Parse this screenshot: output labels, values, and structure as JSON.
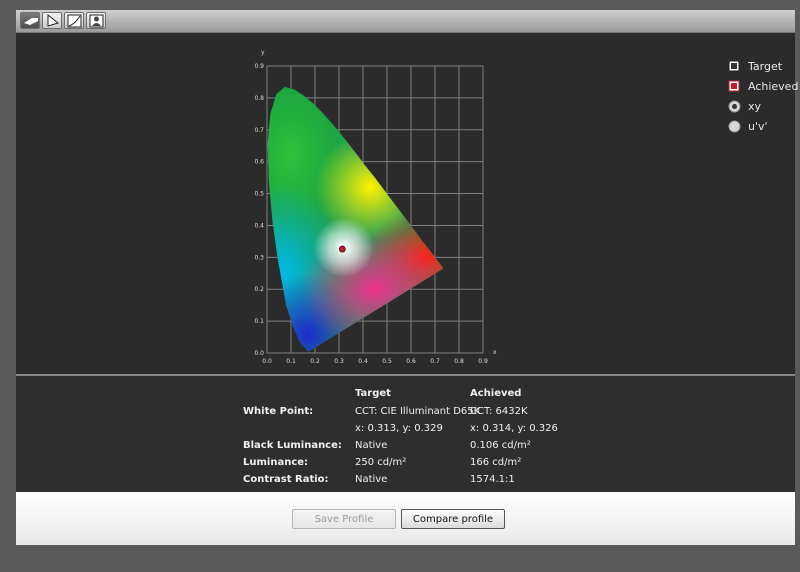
{
  "toolbar": {
    "buttons": [
      {
        "name": "display-tool-icon",
        "active": true
      },
      {
        "name": "gamut-tool-icon",
        "active": false
      },
      {
        "name": "curve-tool-icon",
        "active": false
      },
      {
        "name": "portrait-tool-icon",
        "active": false
      }
    ]
  },
  "legend": {
    "target_label": "Target",
    "achieved_label": "Achieved",
    "radio_xy_label": "xy",
    "radio_uv_label": "u'v'",
    "selected": "xy"
  },
  "chart_data": {
    "type": "scatter",
    "title": "",
    "xlabel": "x",
    "ylabel": "y",
    "xlim": [
      0,
      0.9
    ],
    "ylim": [
      0,
      0.9
    ],
    "x_ticks": [
      "0.0",
      "0.1",
      "0.2",
      "0.3",
      "0.4",
      "0.5",
      "0.6",
      "0.7",
      "0.8",
      "0.9"
    ],
    "y_ticks": [
      "0.0",
      "0.1",
      "0.2",
      "0.3",
      "0.4",
      "0.5",
      "0.6",
      "0.7",
      "0.8",
      "0.9"
    ],
    "grid": true,
    "series": [
      {
        "name": "Target",
        "points": [
          [
            0.313,
            0.329
          ]
        ]
      },
      {
        "name": "Achieved",
        "points": [
          [
            0.314,
            0.326
          ]
        ]
      }
    ]
  },
  "info": {
    "headers": {
      "target": "Target",
      "achieved": "Achieved"
    },
    "rows": [
      {
        "label": "White Point:",
        "target": "CCT: CIE Illuminant D65K",
        "achieved": "CCT: 6432K"
      },
      {
        "label": "",
        "target": "x: 0.313, y: 0.329",
        "achieved": "x: 0.314, y: 0.326"
      },
      {
        "label": "Black Luminance:",
        "target": "Native",
        "achieved": "0.106 cd/m²"
      },
      {
        "label": "Luminance:",
        "target": "250 cd/m²",
        "achieved": "166 cd/m²"
      },
      {
        "label": "Contrast Ratio:",
        "target": "Native",
        "achieved": "1574.1:1"
      }
    ]
  },
  "footer": {
    "save_label": "Save Profile",
    "compare_label": "Compare profile"
  },
  "colors": {
    "grid": "#808080",
    "marker": "#c01e2e",
    "background": "#2e2e2e"
  }
}
